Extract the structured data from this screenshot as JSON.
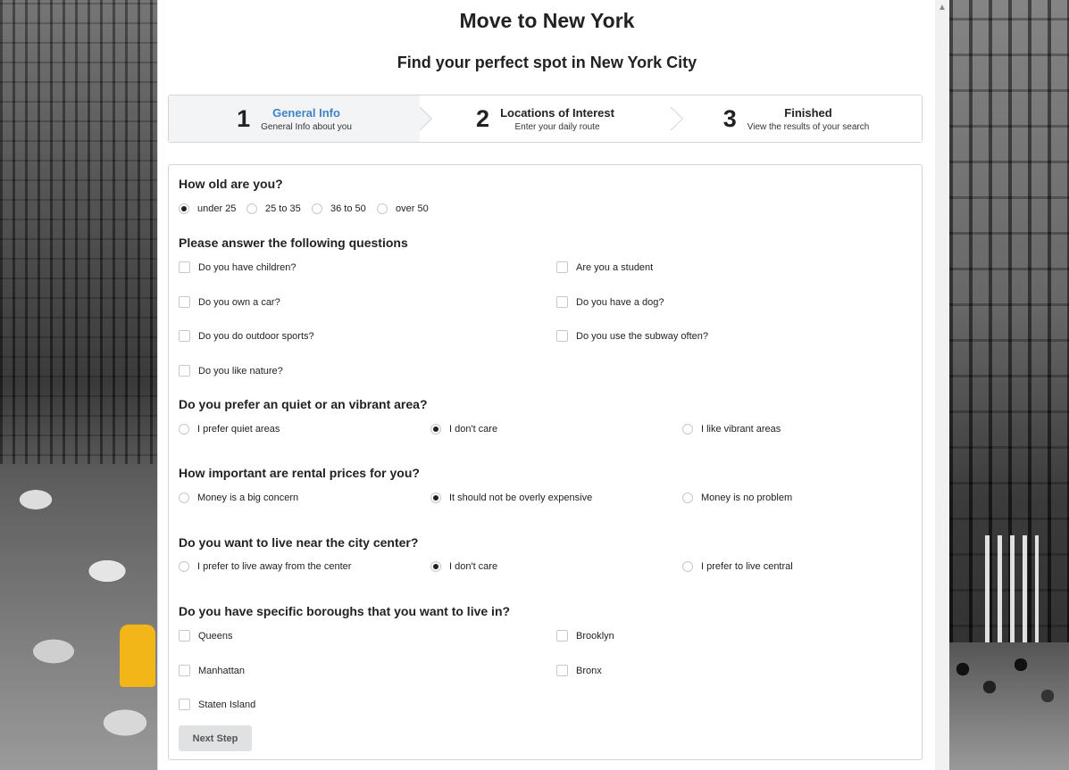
{
  "header": {
    "title": "Move to New York",
    "subtitle": "Find your perfect spot in New York City"
  },
  "steps": [
    {
      "number": "1",
      "title": "General Info",
      "description": "General Info about you",
      "active": true
    },
    {
      "number": "2",
      "title": "Locations of Interest",
      "description": "Enter your daily route",
      "active": false
    },
    {
      "number": "3",
      "title": "Finished",
      "description": "View the results of your search",
      "active": false
    }
  ],
  "age": {
    "question": "How old are you?",
    "options": [
      "under 25",
      "25 to 35",
      "36 to 50",
      "over 50"
    ],
    "selected": "under 25"
  },
  "questions": {
    "heading": "Please answer the following questions",
    "items": [
      "Do you have children?",
      "Are you a student",
      "Do you own a car?",
      "Do you have a dog?",
      "Do you do outdoor sports?",
      "Do you use the subway often?",
      "Do you like nature?"
    ]
  },
  "area": {
    "question": "Do you prefer an quiet or an vibrant area?",
    "options": [
      "I prefer quiet areas",
      "I don't care",
      "I like vibrant areas"
    ],
    "selected": "I don't care"
  },
  "rent": {
    "question": "How important are rental prices for you?",
    "options": [
      "Money is a big concern",
      "It should not be overly expensive",
      "Money is no problem"
    ],
    "selected": "It should not be overly expensive"
  },
  "center": {
    "question": "Do you want to live near the city center?",
    "options": [
      "I prefer to live away from the center",
      "I don't care",
      "I prefer to live central"
    ],
    "selected": "I don't care"
  },
  "boroughs": {
    "question": "Do you have specific boroughs that you want to live in?",
    "items": [
      "Queens",
      "Brooklyn",
      "Manhattan",
      "Bronx",
      "Staten Island"
    ]
  },
  "actions": {
    "next_label": "Next Step"
  },
  "colors": {
    "active_step": "#4183c4",
    "button_bg": "#e0e1e2"
  }
}
